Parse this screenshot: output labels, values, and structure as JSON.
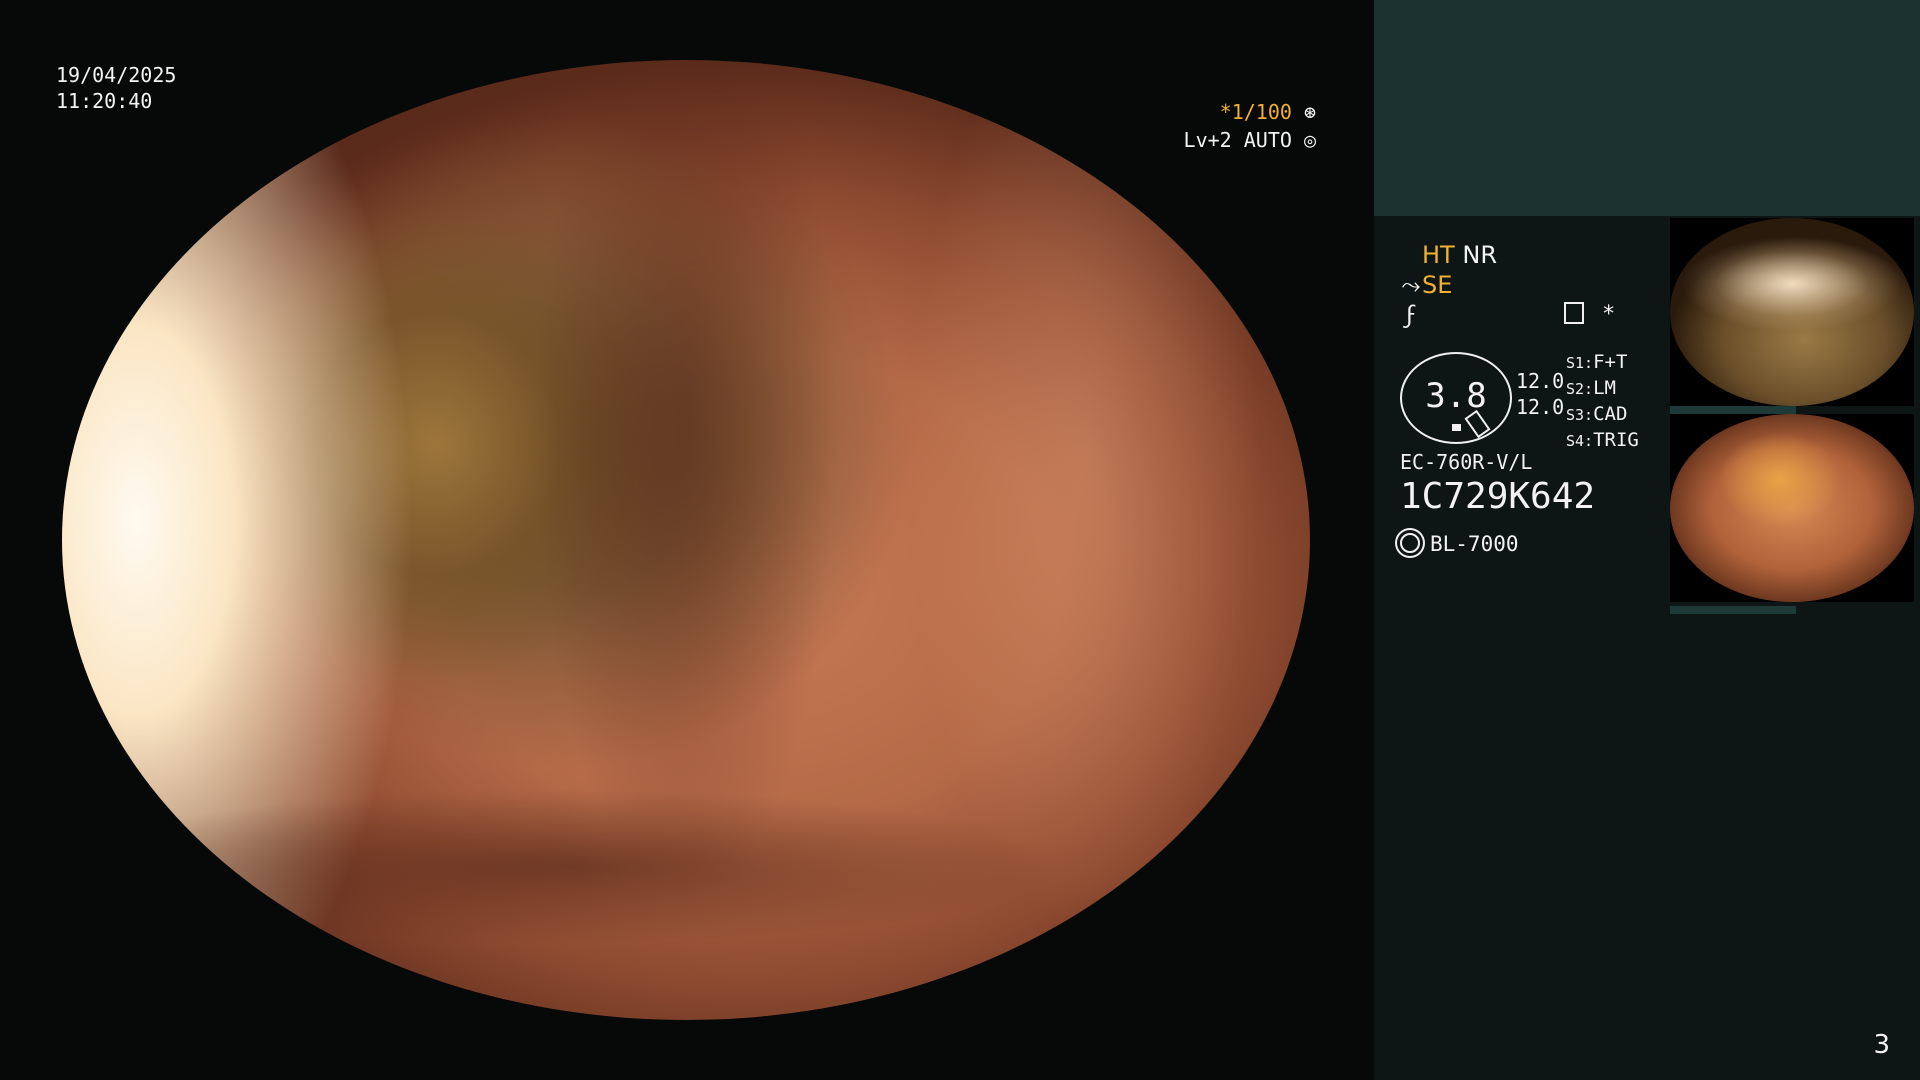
{
  "header": {
    "date": "19/04/2025",
    "time": "11:20:40"
  },
  "shutter": {
    "speed": "*1/100",
    "speed_icon": "aperture-icon",
    "level": "Lv+2 AUTO",
    "level_icon": "iris-icon"
  },
  "modes": {
    "ht": "HT",
    "nr": "NR",
    "se": "SE",
    "line3_icon": "curve-icon"
  },
  "ring": {
    "value": "3.8"
  },
  "settings_left": [
    "12.0",
    "12.0"
  ],
  "settings_right": [
    {
      "key": "S1:",
      "val": "F+T"
    },
    {
      "key": "S2:",
      "val": "LM"
    },
    {
      "key": "S3:",
      "val": "CAD"
    },
    {
      "key": "S4:",
      "val": "TRIG"
    }
  ],
  "scope": {
    "model": "EC-760R-V/L",
    "serial": "1C729K642",
    "light_source": "BL-7000"
  },
  "marker": "*",
  "page_number": "3",
  "colors": {
    "accent": "#f0b030",
    "panel": "#0e1615",
    "panel_header": "#1b3230"
  }
}
